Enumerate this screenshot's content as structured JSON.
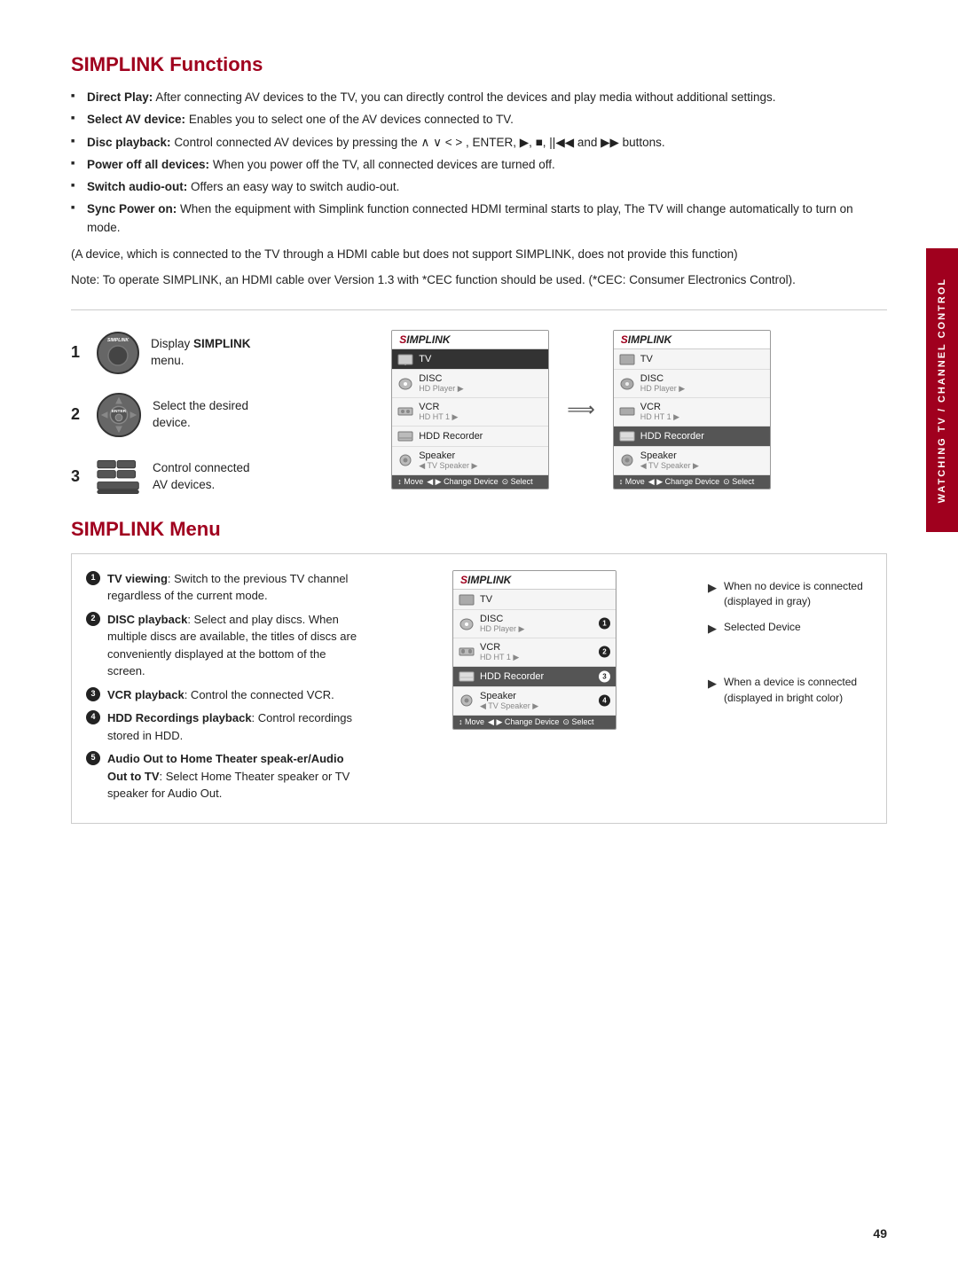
{
  "page": {
    "number": "49",
    "side_tab": "WATCHING TV / CHANNEL CONTROL"
  },
  "section1": {
    "title": "SIMPLINK Functions",
    "bullets": [
      {
        "bold": "Direct Play:",
        "text": " After connecting AV devices to the TV, you can directly control the devices and play media without additional settings."
      },
      {
        "bold": "Select AV device:",
        "text": " Enables you to select one of the AV devices connected to TV."
      },
      {
        "bold": "Disc playback:",
        "text": " Control connected AV devices by pressing the ∧ ∨ < > , ENTER, ▶, ■, ||◀◀ and ▶▶ buttons."
      },
      {
        "bold": "Power off all devices:",
        "text": " When you power off the TV, all connected devices are turned off."
      },
      {
        "bold": "Switch audio-out:",
        "text": " Offers an easy way to switch audio-out."
      },
      {
        "bold": "Sync Power on:",
        "text": " When the equipment with Simplink function connected HDMI terminal starts to play, The TV will change automatically to turn on mode."
      }
    ],
    "note1": "(A device, which is connected to the TV through a HDMI cable but does not support SIMPLINK, does not provide this function)",
    "note2": "Note: To operate SIMPLINK, an HDMI cable over Version 1.3 with *CEC function should be used. (*CEC: Consumer Electronics Control)."
  },
  "steps": [
    {
      "number": "1",
      "label": "Display SIMPLINK menu.",
      "bold_word": "SIMPLINK"
    },
    {
      "number": "2",
      "label": "Select the desired device."
    },
    {
      "number": "3",
      "label": "Control connected AV devices."
    }
  ],
  "simplink_menu_left": {
    "header": "Simplink",
    "items": [
      {
        "icon": "tv",
        "name": "TV",
        "sub": "",
        "selected": true
      },
      {
        "icon": "disc",
        "name": "DISC",
        "sub": "HD Player ▶",
        "selected": false
      },
      {
        "icon": "vcr",
        "name": "VCR",
        "sub": "HD HT 1 ▶",
        "selected": false
      },
      {
        "icon": "hdd",
        "name": "HDD Recorder",
        "sub": "",
        "selected": false
      },
      {
        "icon": "speaker",
        "name": "Speaker",
        "sub": "◀ TV Speaker ▶",
        "selected": false
      }
    ],
    "footer": "↕ Move   ◀ ▶ Change Device   ⊙ Select"
  },
  "simplink_menu_right": {
    "header": "Simplink",
    "items": [
      {
        "icon": "tv",
        "name": "TV",
        "sub": "",
        "selected": false
      },
      {
        "icon": "disc",
        "name": "DISC",
        "sub": "HD Player ▶",
        "selected": false
      },
      {
        "icon": "vcr",
        "name": "VCR",
        "sub": "HD HT 1 ▶",
        "selected": false
      },
      {
        "icon": "hdd",
        "name": "HDD Recorder",
        "sub": "",
        "selected": true
      },
      {
        "icon": "speaker",
        "name": "Speaker",
        "sub": "◀ TV Speaker ▶",
        "selected": false
      }
    ],
    "footer": "↕ Move   ◀ ▶ Change Device   ⊙ Select"
  },
  "section2": {
    "title": "SIMPLINK Menu",
    "items": [
      {
        "num": "1",
        "bold": "TV viewing",
        "text": ": Switch to the previous TV channel regardless of the current mode."
      },
      {
        "num": "2",
        "bold": "DISC playback",
        "text": ": Select and play discs. When multiple discs are available, the titles of discs are conveniently displayed at the bottom of the screen."
      },
      {
        "num": "3",
        "bold": "VCR playback",
        "text": ": Control the connected VCR."
      },
      {
        "num": "4",
        "bold": "HDD Recordings playback",
        "text": ": Control recordings stored in HDD."
      },
      {
        "num": "5",
        "bold": "Audio Out to Home Theater speak-er/Audio Out to TV",
        "text": ": Select Home Theater speaker or TV speaker for Audio Out."
      }
    ],
    "simplink_box": {
      "header": "Simplink",
      "items": [
        {
          "icon": "tv",
          "name": "TV",
          "sub": "",
          "badge": null,
          "selected": false
        },
        {
          "icon": "disc",
          "name": "DISC",
          "sub": "HD Player ▶",
          "badge": "1",
          "selected": false
        },
        {
          "icon": "vcr",
          "name": "VCR",
          "sub": "HD HT 1 ▶",
          "badge": "2",
          "selected": false
        },
        {
          "icon": "hdd",
          "name": "HDD Recorder",
          "sub": "",
          "badge": "3",
          "selected": true
        },
        {
          "icon": "speaker",
          "name": "Speaker",
          "sub": "◀ TV Speaker ▶",
          "badge": "4",
          "selected": false
        }
      ],
      "footer": "↕ Move   ◀ ▶ Change Device   ⊙ Select"
    },
    "legend": [
      {
        "arrow": "▶",
        "text": "When no device is connected (displayed in gray)"
      },
      {
        "arrow": "▶",
        "text": "Selected Device"
      },
      {
        "arrow": "▶",
        "text": "When a device is connected (displayed in bright color)"
      }
    ]
  }
}
